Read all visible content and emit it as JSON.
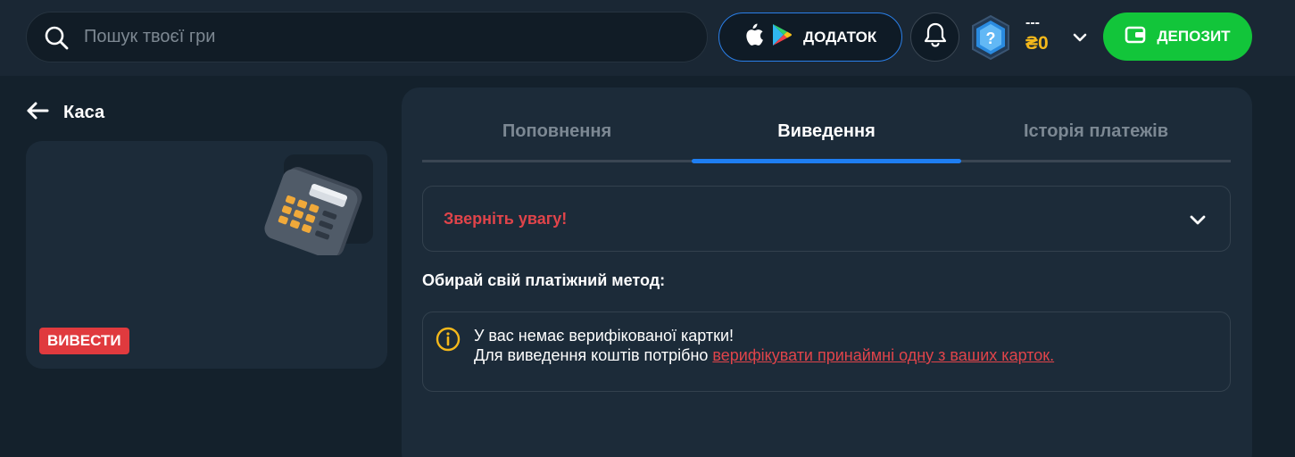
{
  "header": {
    "search_placeholder": "Пошук твоєї гри",
    "app_button_label": "ДОДАТОК",
    "user_name": "---",
    "balance": "₴0",
    "deposit_label": "ДЕПОЗИТ",
    "rank_badge_symbol": "?"
  },
  "sidebar": {
    "back_title": "Каса",
    "card_badge": "ВИВЕСТИ"
  },
  "main": {
    "tabs": [
      {
        "label": "Поповнення",
        "active": false
      },
      {
        "label": "Виведення",
        "active": true
      },
      {
        "label": "Історія платежів",
        "active": false
      }
    ],
    "attention_label": "Зверніть увагу!",
    "choose_method_label": "Обирай свій платіжний метод:",
    "warning": {
      "line1": "У вас немає верифікованої картки!",
      "line2_prefix": "Для виведення коштів потрібно ",
      "line2_link": "верифікувати принаймні одну з ваших карток."
    }
  },
  "colors": {
    "accent_blue": "#1e7ef2",
    "deposit_green": "#12c53a",
    "alert_red": "#e0444a",
    "balance_gold": "#f4b81b"
  }
}
